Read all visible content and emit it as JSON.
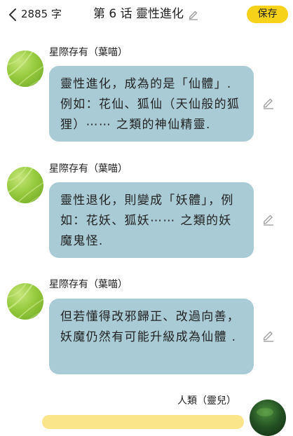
{
  "header": {
    "back_icon": "chevron-left-icon",
    "word_count": "2885 字",
    "title": "第 6 话  靈性進化",
    "title_edit_icon": "pencil-icon",
    "save_label": "保存",
    "save_color": "#f7d21b"
  },
  "messages": [
    {
      "sender": "星際存有（葉喵）",
      "text": "靈性進化，成為的是「仙體」.例如：花仙、狐仙（天仙般的狐狸）⋯⋯ 之類的神仙精靈.",
      "bubble_color": "#a9cbd6",
      "edit_icon": "pencil-icon"
    },
    {
      "sender": "星際存有（葉喵）",
      "text": "靈性退化，則變成「妖體」，例如：花妖、狐妖⋯⋯ 之類的妖魔鬼怪.",
      "bubble_color": "#a9cbd6",
      "edit_icon": "pencil-icon"
    },
    {
      "sender": "星際存有（葉喵）",
      "text": "但若懂得改邪歸正、改過向善，妖魔仍然有可能升級成為仙體 .",
      "bubble_color": "#a9cbd6",
      "edit_icon": "pencil-icon"
    },
    {
      "sender": "人類（靈兒）",
      "bubble_color": "#fbe58a"
    }
  ]
}
